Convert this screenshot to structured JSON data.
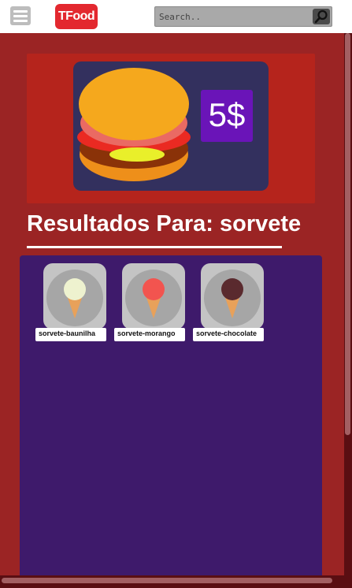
{
  "header": {
    "logo_text": "TFood",
    "menu_icon": "hamburger-icon",
    "search_placeholder": "Search..",
    "search_icon": "search-icon"
  },
  "banner": {
    "price": "5$",
    "colors": {
      "panel": "#b5241c",
      "card": "#33305e",
      "price_bg": "#6a14b8"
    }
  },
  "results": {
    "title": "Resultados Para: sorvete",
    "items": [
      {
        "label": "sorvete-baunilha",
        "scoop_color": "#eef2cf",
        "icon": "ice-cream-icon"
      },
      {
        "label": "sorvete-morango",
        "scoop_color": "#f2544f",
        "icon": "ice-cream-icon"
      },
      {
        "label": "sorvete-chocolate",
        "scoop_color": "#5a2a2e",
        "icon": "ice-cream-icon"
      }
    ]
  }
}
